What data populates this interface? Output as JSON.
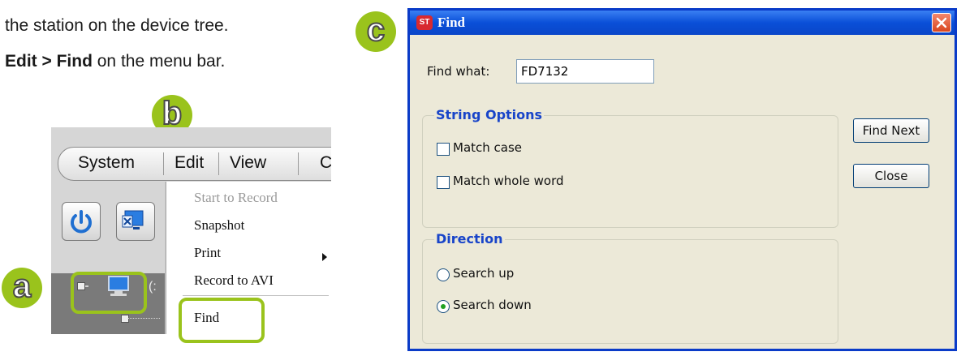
{
  "instructions": {
    "line1": "the station on the device tree.",
    "line2_bold": "Edit > Find",
    "line2_rest": " on the menu bar."
  },
  "badges": {
    "a": "a",
    "b": "b",
    "c": "c"
  },
  "app": {
    "menu": [
      "System",
      "Edit",
      "View",
      "C"
    ],
    "tree_label": "(:",
    "edit_menu": {
      "items": [
        {
          "label": "Start to Record",
          "mnemonic": "R",
          "disabled": true
        },
        {
          "label": "Snapshot",
          "mnemonic": "n"
        },
        {
          "label": "Print",
          "mnemonic": "P",
          "submenu": true
        },
        {
          "label": "Record to AVI",
          "mnemonic": "A"
        },
        {
          "label": "Find",
          "mnemonic": "F"
        }
      ]
    }
  },
  "dialog": {
    "title": "Find",
    "find_what_label": "Find what:",
    "find_what_value": "FD7132",
    "string_options": {
      "title": "String Options",
      "match_case": "Match case",
      "match_whole_word": "Match whole word"
    },
    "direction": {
      "title": "Direction",
      "search_up": "Search up",
      "search_down": "Search down",
      "selected": "Search down"
    },
    "buttons": {
      "find_next": "Find Next",
      "close": "Close"
    }
  },
  "colors": {
    "badge": "#9ac31c",
    "titlebar": "#0a4fd8",
    "group_title": "#1844c9"
  }
}
